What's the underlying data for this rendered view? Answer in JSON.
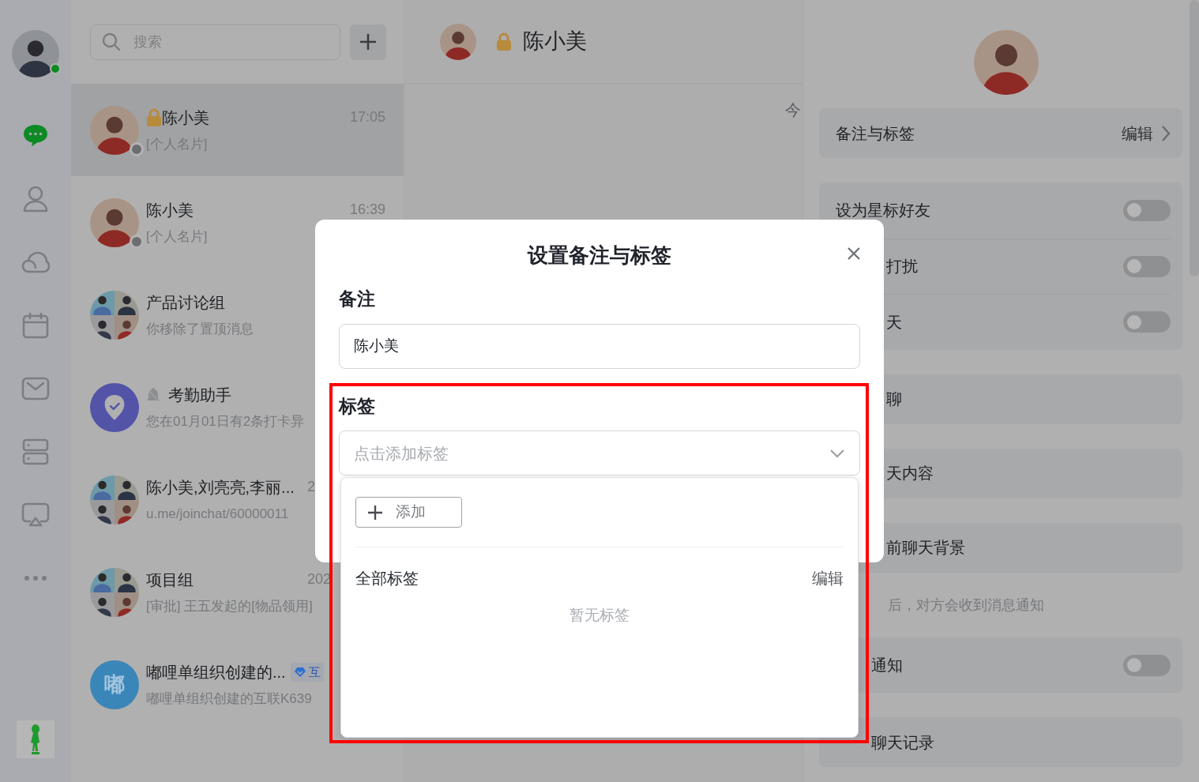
{
  "nav": {
    "user": {
      "online": true
    },
    "items": [
      {
        "kind": "chat",
        "selected": true
      },
      {
        "kind": "contacts",
        "selected": false
      },
      {
        "kind": "cloud",
        "selected": false
      },
      {
        "kind": "calendar",
        "selected": false
      },
      {
        "kind": "mail",
        "selected": false
      },
      {
        "kind": "server",
        "selected": false
      },
      {
        "kind": "cast",
        "selected": false
      },
      {
        "kind": "more",
        "selected": false
      }
    ]
  },
  "chat_list": {
    "search": {
      "placeholder": "搜索"
    },
    "items": [
      {
        "kind": "photo",
        "name": "陈小美",
        "locked": true,
        "time": "17:05",
        "preview": "[个人名片]",
        "online": false,
        "selected": true
      },
      {
        "kind": "photo",
        "name": "陈小美",
        "time": "16:39",
        "preview": "[个人名片]",
        "online": false,
        "selected": false
      },
      {
        "kind": "group",
        "name": "产品讨论组",
        "preview": "你移除了置顶消息",
        "selected": false
      },
      {
        "kind": "shield",
        "name": "考勤助手",
        "muted": true,
        "preview": "您在01月01日有2条打卡异",
        "selected": false
      },
      {
        "kind": "group",
        "name": "陈小美,刘亮亮,李丽...",
        "time": "2",
        "preview": "u.me/joinchat/60000011",
        "selected": false
      },
      {
        "kind": "group",
        "name": "项目组",
        "time": "202",
        "preview": "[审批] 王五发起的[物品领用]",
        "selected": false
      },
      {
        "kind": "letter",
        "letter": "嘟",
        "name": "嘟哩单组织创建的...",
        "badge": "互",
        "preview": "嘟哩单组织创建的互联K639",
        "selected": false
      }
    ]
  },
  "chat": {
    "name": "陈小美",
    "locked": true,
    "date_hint": "今"
  },
  "profile": {
    "sections": [
      {
        "kind": "card",
        "rows": [
          {
            "kind": "link",
            "label": "备注与标签",
            "action": "编辑"
          }
        ]
      },
      {
        "kind": "card",
        "rows": [
          {
            "kind": "toggle",
            "label": "设为星标好友",
            "on": false
          },
          {
            "kind": "toggle",
            "label": "打扰",
            "on": false
          },
          {
            "kind": "toggle",
            "label": "天",
            "on": false
          }
        ]
      },
      {
        "kind": "card",
        "rows": [
          {
            "kind": "plain",
            "label": "聊"
          }
        ]
      },
      {
        "kind": "card",
        "rows": [
          {
            "kind": "plain",
            "label": "天内容"
          }
        ]
      },
      {
        "kind": "card",
        "rows": [
          {
            "kind": "plain",
            "label": "前聊天背景"
          }
        ]
      },
      {
        "kind": "note",
        "text": "后，对方会收到消息通知"
      },
      {
        "kind": "card",
        "rows": [
          {
            "kind": "toggle",
            "label": "通知",
            "on": false
          }
        ]
      },
      {
        "kind": "card",
        "rows": [
          {
            "kind": "plain",
            "label": "聊天记录"
          }
        ]
      }
    ]
  },
  "dialog": {
    "title": "设置备注与标签",
    "remark_label": "备注",
    "remark_value": "陈小美",
    "tags_label": "标签",
    "tags_placeholder": "点击添加标签",
    "dropdown": {
      "add_button": "添加",
      "all_tags": "全部标签",
      "edit": "编辑",
      "empty": "暂无标签"
    }
  },
  "annotation": {
    "kind": "frame"
  }
}
